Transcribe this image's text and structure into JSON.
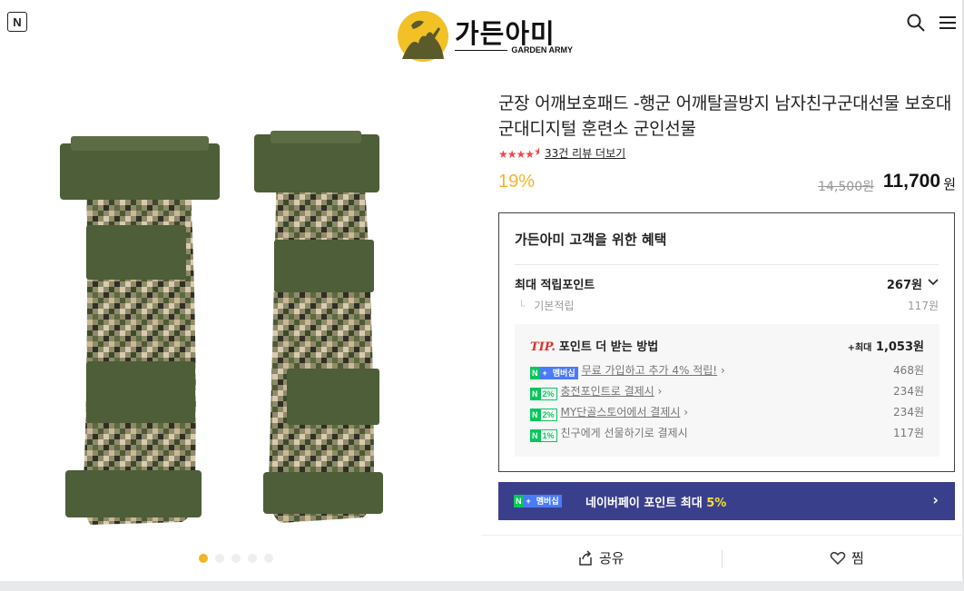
{
  "header": {
    "n_button": "N",
    "logo_title": "가든아미",
    "logo_sub": "GARDEN ARMY",
    "icons": [
      "search-icon",
      "menu-icon"
    ]
  },
  "gallery": {
    "dot_count": 5,
    "active_index": 0
  },
  "product": {
    "title": "군장 어깨보호패드 -행군 어깨탈골방지 남자친구군대선물 보호대 군대디지털 훈련소 군인선물",
    "rating_stars": 4.5,
    "review_link": "33건 리뷰 더보기",
    "discount": "19%",
    "original_price": "14,500원",
    "price": "11,700",
    "price_unit": "원"
  },
  "benefit": {
    "title": "가든아미 고객을 위한 혜택",
    "max_points_label": "최대 적립포인트",
    "max_points_value": "267원",
    "base_label": "기본적립",
    "base_value": "117원",
    "tip": {
      "tip_label": "TIP.",
      "heading": "포인트 더 받는 방법",
      "max_prefix": "+최대",
      "max_value": "1,053원",
      "items": [
        {
          "badge": "멤버십",
          "text": "무료 가입하고 추가 4% 적립!",
          "value": "468원"
        },
        {
          "badge": "2%",
          "text": "충전포인트로 결제시",
          "value": "234원"
        },
        {
          "badge": "2%",
          "text": "MY단골스토어에서 결제시",
          "value": "234원"
        },
        {
          "badge": "1%",
          "text": "친구에게 선물하기로 결제시",
          "value": "117원"
        }
      ]
    }
  },
  "npay": {
    "badge": "멤버십",
    "label": "네이버페이 포인트 최대",
    "highlight": "5%"
  },
  "actions": {
    "share": "공유",
    "wish": "찜"
  },
  "colors": {
    "accent": "#f1b629",
    "npay_bg": "#3a3f8c",
    "naver_green": "#03c75a",
    "star": "#f2464c"
  }
}
